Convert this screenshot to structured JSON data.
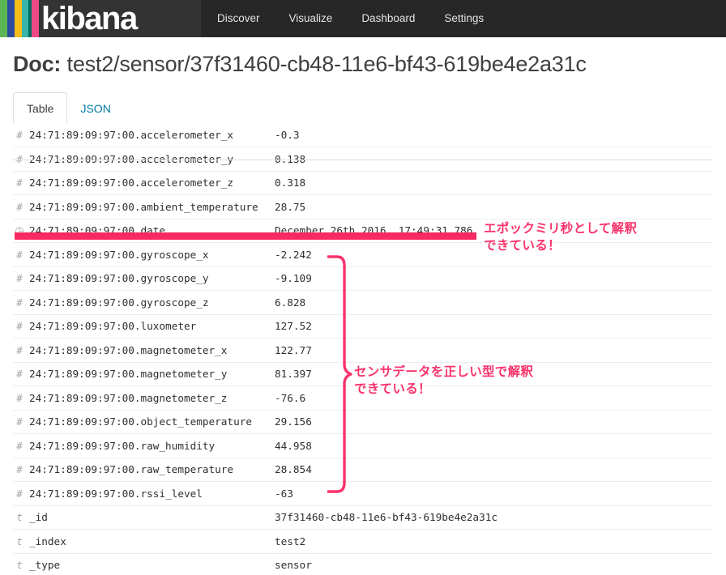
{
  "navbar": {
    "brand": "kibana",
    "logo_stripe_colors": [
      "#5ab552",
      "#2e4c9e",
      "#f4bd1a",
      "#38b4a8",
      "#036b5d",
      "#ef4a87"
    ],
    "links": [
      {
        "label": "Discover"
      },
      {
        "label": "Visualize"
      },
      {
        "label": "Dashboard"
      },
      {
        "label": "Settings"
      }
    ]
  },
  "page": {
    "title_prefix": "Doc:",
    "title_value": "test2/sensor/37f31460-cb48-11e6-bf43-619be4e2a31c"
  },
  "tabs": [
    {
      "label": "Table",
      "active": true
    },
    {
      "label": "JSON",
      "active": false
    }
  ],
  "table": {
    "rows": [
      {
        "icon": "#",
        "type": "number",
        "field": "24:71:89:09:97:00.accelerometer_x",
        "value": "-0.3"
      },
      {
        "icon": "#",
        "type": "number",
        "field": "24:71:89:09:97:00.accelerometer_y",
        "value": "0.138"
      },
      {
        "icon": "#",
        "type": "number",
        "field": "24:71:89:09:97:00.accelerometer_z",
        "value": "0.318"
      },
      {
        "icon": "#",
        "type": "number",
        "field": "24:71:89:09:97:00.ambient_temperature",
        "value": "28.75"
      },
      {
        "icon": "clock",
        "type": "date",
        "field": "24:71:89:09:97:00.date",
        "value": "December 26th 2016, 17:49:31.786",
        "highlighted": true
      },
      {
        "icon": "#",
        "type": "number",
        "field": "24:71:89:09:97:00.gyroscope_x",
        "value": "-2.242"
      },
      {
        "icon": "#",
        "type": "number",
        "field": "24:71:89:09:97:00.gyroscope_y",
        "value": "-9.109"
      },
      {
        "icon": "#",
        "type": "number",
        "field": "24:71:89:09:97:00.gyroscope_z",
        "value": "6.828"
      },
      {
        "icon": "#",
        "type": "number",
        "field": "24:71:89:09:97:00.luxometer",
        "value": "127.52"
      },
      {
        "icon": "#",
        "type": "number",
        "field": "24:71:89:09:97:00.magnetometer_x",
        "value": "122.77"
      },
      {
        "icon": "#",
        "type": "number",
        "field": "24:71:89:09:97:00.magnetometer_y",
        "value": "81.397"
      },
      {
        "icon": "#",
        "type": "number",
        "field": "24:71:89:09:97:00.magnetometer_z",
        "value": "-76.6"
      },
      {
        "icon": "#",
        "type": "number",
        "field": "24:71:89:09:97:00.object_temperature",
        "value": "29.156"
      },
      {
        "icon": "#",
        "type": "number",
        "field": "24:71:89:09:97:00.raw_humidity",
        "value": "44.958"
      },
      {
        "icon": "#",
        "type": "number",
        "field": "24:71:89:09:97:00.raw_temperature",
        "value": "28.854"
      },
      {
        "icon": "#",
        "type": "number",
        "field": "24:71:89:09:97:00.rssi_level",
        "value": "-63"
      },
      {
        "icon": "t",
        "type": "string",
        "field": "_id",
        "value": "37f31460-cb48-11e6-bf43-619be4e2a31c"
      },
      {
        "icon": "t",
        "type": "string",
        "field": "_index",
        "value": "test2"
      },
      {
        "icon": "t",
        "type": "string",
        "field": "_type",
        "value": "sensor"
      }
    ]
  },
  "annotations": {
    "accent_color": "#f9336b",
    "epoch_note": "エポックミリ秒として解釈\nできている！",
    "sensor_note": "センサデータを正しい型で解釈\nできている！"
  }
}
